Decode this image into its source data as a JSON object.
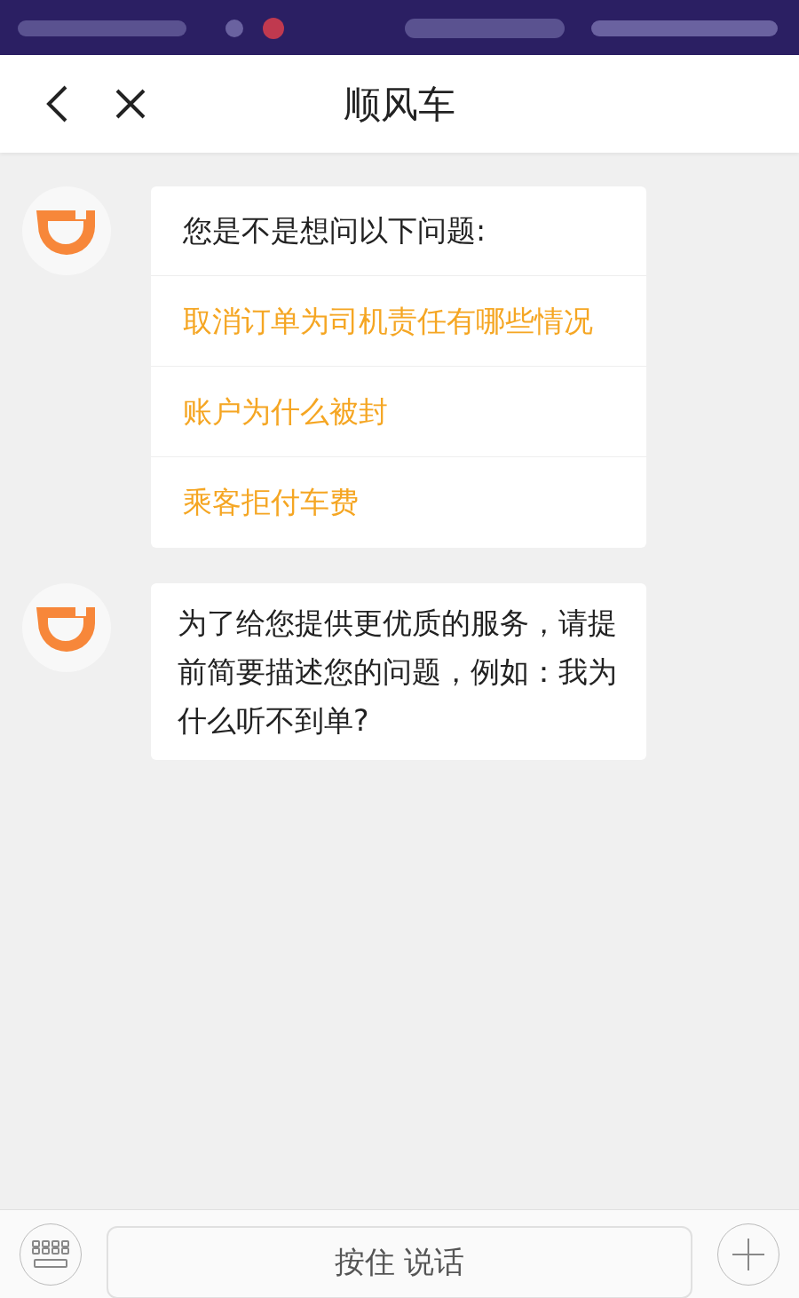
{
  "header": {
    "title": "顺风车"
  },
  "messages": [
    {
      "kind": "suggestions",
      "prompt": "您是不是想问以下问题:",
      "options": [
        "取消订单为司机责任有哪些情况",
        "账户为什么被封",
        "乘客拒付车费"
      ]
    },
    {
      "kind": "text",
      "text": "为了给您提供更优质的服务，请提前简要描述您的问题，例如：我为什么听不到单?"
    }
  ],
  "input_bar": {
    "hold_to_talk": "按住 说话"
  }
}
